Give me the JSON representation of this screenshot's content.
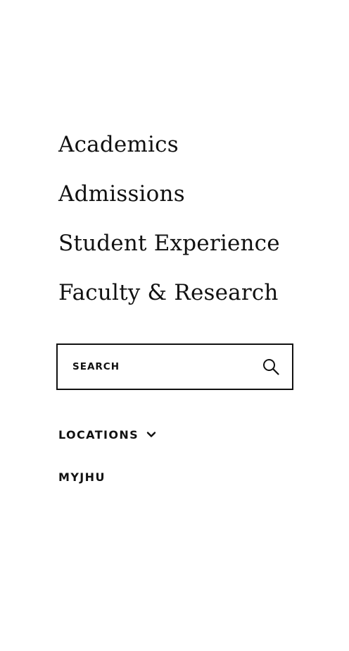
{
  "primary_nav": {
    "items": [
      {
        "label": "Academics"
      },
      {
        "label": "Admissions"
      },
      {
        "label": "Student Experience"
      },
      {
        "label": "Faculty & Research"
      }
    ]
  },
  "search": {
    "placeholder": "SEARCH",
    "value": "",
    "button_icon": "search-icon"
  },
  "secondary": {
    "locations_label": "LOCATIONS",
    "locations_icon": "chevron-down-icon",
    "myjhu_label": "MYJHU"
  }
}
